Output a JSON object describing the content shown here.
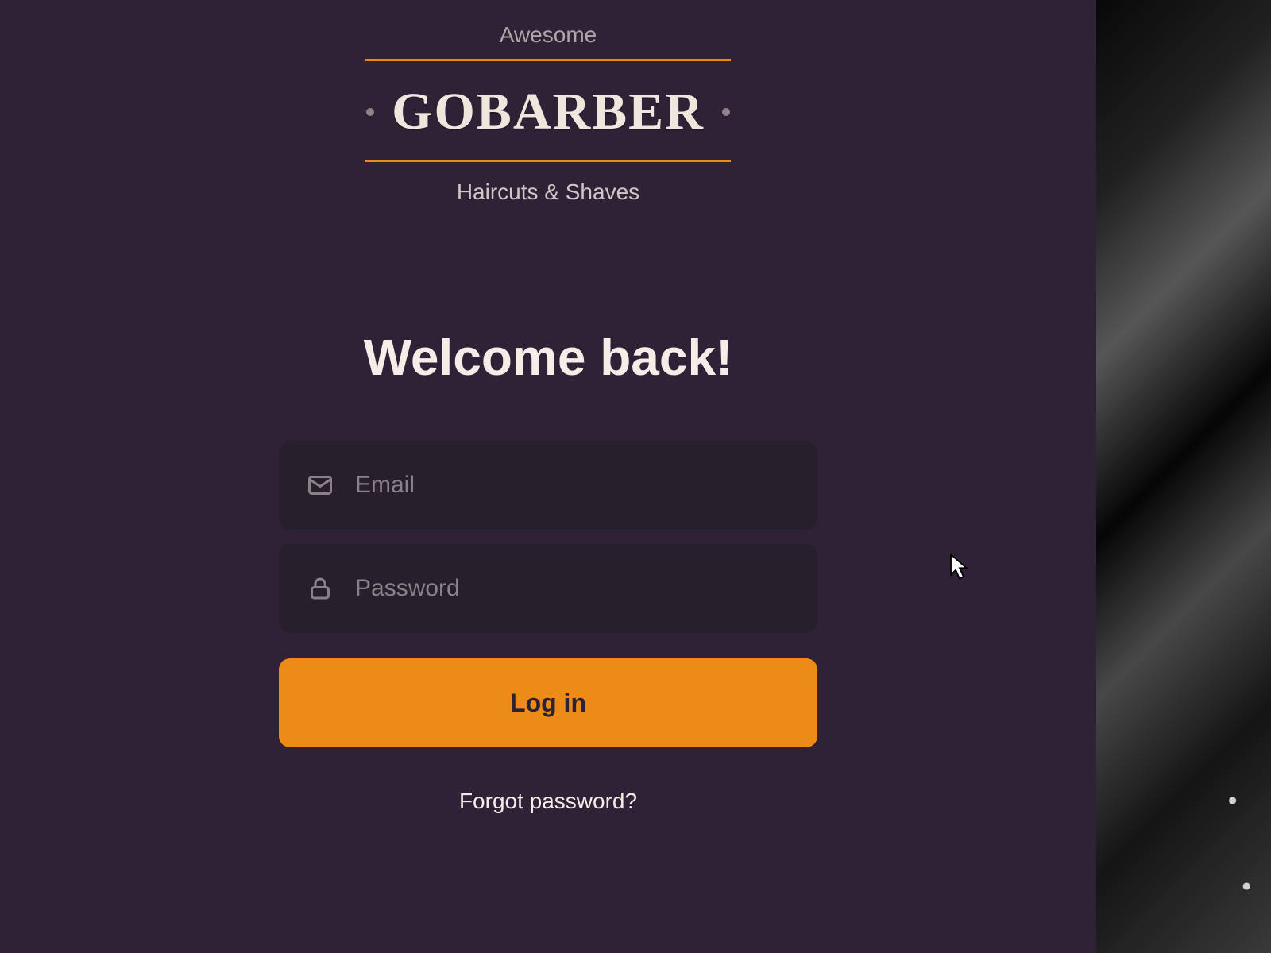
{
  "brand": {
    "top_word": "Awesome",
    "name": "GoBarber",
    "tagline": "Haircuts & Shaves"
  },
  "headline": "Welcome back!",
  "form": {
    "email": {
      "placeholder": "Email",
      "value": ""
    },
    "password": {
      "placeholder": "Password",
      "value": ""
    },
    "submit_label": "Log in",
    "forgot_label": "Forgot password?"
  },
  "colors": {
    "accent": "#ed8b18",
    "bg": "#2f2136",
    "field_bg": "#27202c",
    "text": "#f4ede8"
  }
}
